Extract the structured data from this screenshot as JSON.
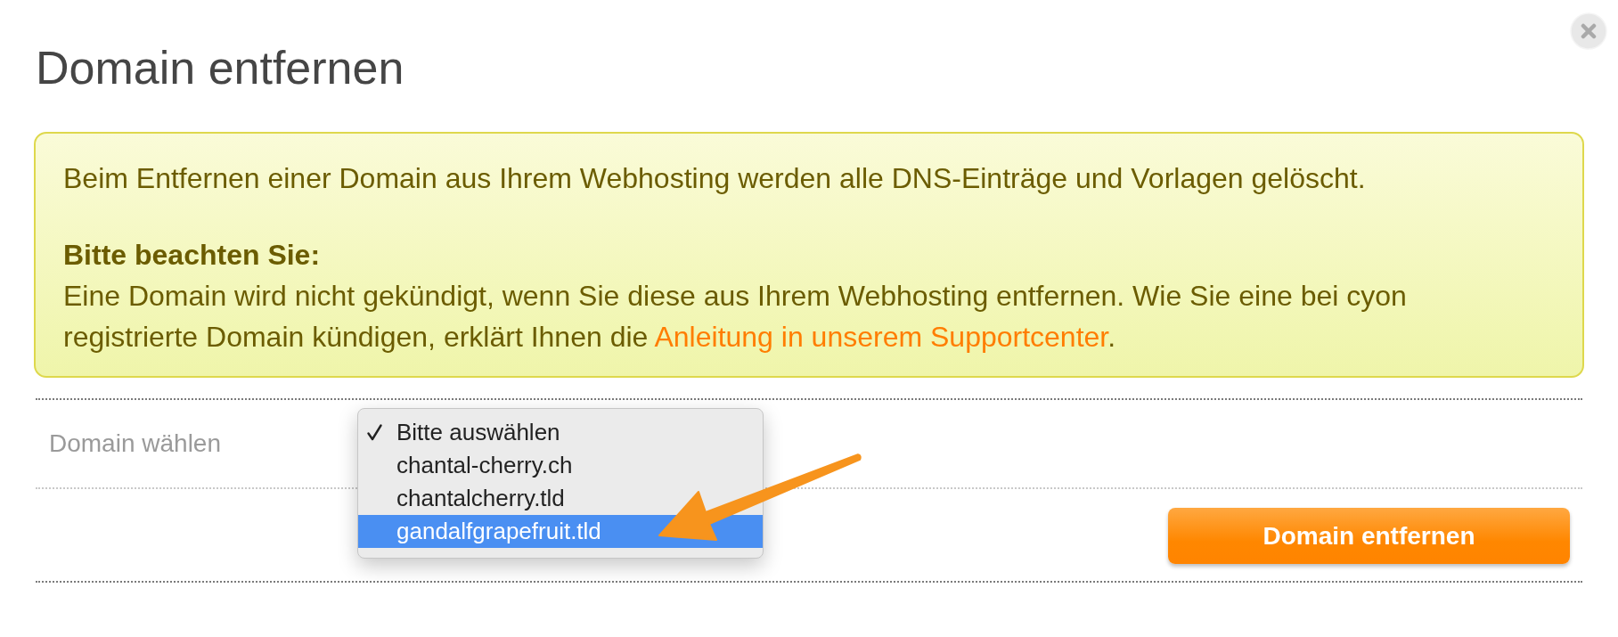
{
  "dialog": {
    "title": "Domain entfernen"
  },
  "notice": {
    "message": "Beim Entfernen einer Domain aus Ihrem Webhosting werden alle DNS-Einträge und Vorlagen gelöscht.",
    "note_heading": "Bitte beachten Sie:",
    "note_text": "Eine Domain wird nicht gekündigt, wenn Sie diese aus Ihrem Webhosting entfernen. Wie Sie eine bei cyon registrierte Domain kündigen, erklärt Ihnen die",
    "note_link": "Anleitung in unserem Supportcenter",
    "note_end": "."
  },
  "form": {
    "field_label": "Domain wählen",
    "options": [
      {
        "label": "Bitte auswählen",
        "checked": true,
        "selected": false
      },
      {
        "label": "chantal-cherry.ch",
        "checked": false,
        "selected": false
      },
      {
        "label": "chantalcherry.tld",
        "checked": false,
        "selected": false
      },
      {
        "label": "gandalfgrapefruit.tld",
        "checked": false,
        "selected": true
      }
    ],
    "submit_button": "Domain entfernen"
  }
}
